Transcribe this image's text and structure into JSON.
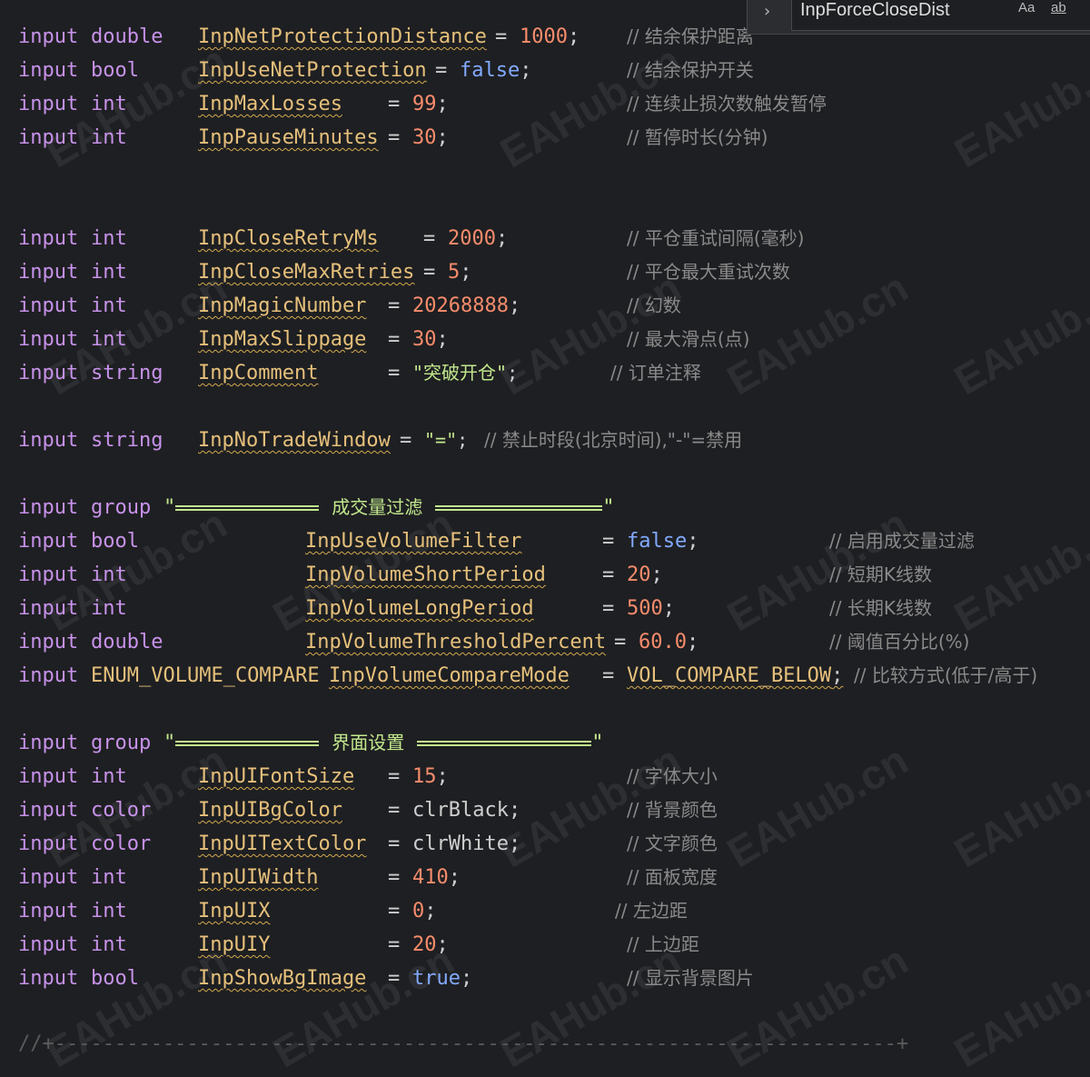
{
  "find": {
    "value": "InpForceCloseDist",
    "match_case": "Aa",
    "whole_word": "ab"
  },
  "watermark": "EAHub.cn",
  "lines": [
    {
      "kw": "input",
      "type": "double",
      "name": "InpNetProtectionDistance",
      "eq": "=",
      "val": "1000",
      "vkind": "num",
      "semi": ";",
      "comment": "// 结余保护距离"
    },
    {
      "kw": "input",
      "type": "bool",
      "name": "InpUseNetProtection",
      "eq": "=",
      "val": "false",
      "vkind": "bool",
      "semi": ";",
      "comment": "// 结余保护开关"
    },
    {
      "kw": "input",
      "type": "int",
      "name": "InpMaxLosses",
      "eq": "=",
      "val": "99",
      "vkind": "num",
      "semi": ";",
      "comment": "// 连续止损次数触发暂停"
    },
    {
      "kw": "input",
      "type": "int",
      "name": "InpPauseMinutes",
      "eq": "=",
      "val": "30",
      "vkind": "num",
      "semi": ";",
      "comment": "// 暂停时长(分钟)"
    },
    {
      "kw": "input",
      "type": "int",
      "name": "InpCloseRetryMs",
      "eq": "=",
      "val": "2000",
      "vkind": "num",
      "semi": ";",
      "comment": "// 平仓重试间隔(毫秒)"
    },
    {
      "kw": "input",
      "type": "int",
      "name": "InpCloseMaxRetries",
      "eq": "=",
      "val": "5",
      "vkind": "num",
      "semi": ";",
      "comment": "// 平仓最大重试次数"
    },
    {
      "kw": "input",
      "type": "int",
      "name": "InpMagicNumber",
      "eq": "=",
      "val": "20268888",
      "vkind": "num",
      "semi": ";",
      "comment": "// 幻数"
    },
    {
      "kw": "input",
      "type": "int",
      "name": "InpMaxSlippage",
      "eq": "=",
      "val": "30",
      "vkind": "num",
      "semi": ";",
      "comment": "// 最大滑点(点)"
    },
    {
      "kw": "input",
      "type": "string",
      "name": "InpComment",
      "eq": "=",
      "val": "\"突破开仓\"",
      "vkind": "str",
      "semi": ";",
      "comment": "// 订单注释"
    },
    {
      "kw": "input",
      "type": "string",
      "name": "InpNoTradeWindow",
      "eq": "=",
      "val": "\"=\"",
      "vkind": "str",
      "semi": ";",
      "comment": "// 禁止时段(北京时间),\"-\"=禁用"
    },
    {
      "kw": "input",
      "type": "group",
      "group_open": "\"",
      "group_title": "成交量过滤",
      "group_close": "\""
    },
    {
      "kw": "input",
      "type": "bool",
      "name": "InpUseVolumeFilter",
      "eq": "=",
      "val": "false",
      "vkind": "bool",
      "semi": ";",
      "comment": "// 启用成交量过滤"
    },
    {
      "kw": "input",
      "type": "int",
      "name": "InpVolumeShortPeriod",
      "eq": "=",
      "val": "20",
      "vkind": "num",
      "semi": ";",
      "comment": "// 短期K线数"
    },
    {
      "kw": "input",
      "type": "int",
      "name": "InpVolumeLongPeriod",
      "eq": "=",
      "val": "500",
      "vkind": "num",
      "semi": ";",
      "comment": "// 长期K线数"
    },
    {
      "kw": "input",
      "type": "double",
      "name": "InpVolumeThresholdPercent",
      "eq": "=",
      "val": "60.0",
      "vkind": "num",
      "semi": ";",
      "comment": "// 阈值百分比(%)"
    },
    {
      "kw": "input",
      "type": "ENUM_VOLUME_COMPARE",
      "name": "InpVolumeCompareMode",
      "eq": "=",
      "val": "VOL_COMPARE_BELOW",
      "vkind": "enum",
      "semi": ";",
      "comment": "// 比较方式(低于/高于)"
    },
    {
      "kw": "input",
      "type": "group",
      "group_open": "\"",
      "group_title": "界面设置",
      "group_close": "\""
    },
    {
      "kw": "input",
      "type": "int",
      "name": "InpUIFontSize",
      "eq": "=",
      "val": "15",
      "vkind": "num",
      "semi": ";",
      "comment": "// 字体大小"
    },
    {
      "kw": "input",
      "type": "color",
      "name": "InpUIBgColor",
      "eq": "=",
      "val": "clrBlack",
      "vkind": "plain",
      "semi": ";",
      "comment": "// 背景颜色"
    },
    {
      "kw": "input",
      "type": "color",
      "name": "InpUITextColor",
      "eq": "=",
      "val": "clrWhite",
      "vkind": "plain",
      "semi": ";",
      "comment": "// 文字颜色"
    },
    {
      "kw": "input",
      "type": "int",
      "name": "InpUIWidth",
      "eq": "=",
      "val": "410",
      "vkind": "num",
      "semi": ";",
      "comment": "// 面板宽度"
    },
    {
      "kw": "input",
      "type": "int",
      "name": "InpUIX",
      "eq": "=",
      "val": "0",
      "vkind": "num",
      "semi": ";",
      "comment": "// 左边距"
    },
    {
      "kw": "input",
      "type": "int",
      "name": "InpUIY",
      "eq": "=",
      "val": "20",
      "vkind": "num",
      "semi": ";",
      "comment": "// 上边距"
    },
    {
      "kw": "input",
      "type": "bool",
      "name": "InpShowBgImage",
      "eq": "=",
      "val": "true",
      "vkind": "bool",
      "semi": ";",
      "comment": "// 显示背景图片"
    }
  ],
  "bottom_divider": "//+----------------------------------------------------------------------+"
}
